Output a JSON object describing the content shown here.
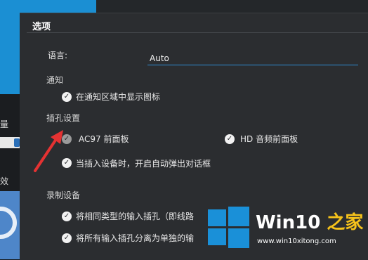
{
  "background": {
    "left_labels": [
      "量",
      "效"
    ]
  },
  "dialog": {
    "title": "选项",
    "language": {
      "label": "语言:",
      "value": "Auto"
    },
    "notify": {
      "heading": "通知",
      "show_icon": {
        "label": "在通知区域中显示图标",
        "checked": true
      }
    },
    "jack": {
      "heading": "插孔设置",
      "ac97": {
        "label": "AC97 前面板",
        "checked": true
      },
      "hd": {
        "label": "HD 音频前面板",
        "checked": true
      },
      "auto_popup": {
        "label": "当插入设备时，开启自动弹出对话框",
        "checked": true
      }
    },
    "record": {
      "heading": "录制设备",
      "same_type": {
        "label": "将相同类型的输入插孔（即线路",
        "checked": true
      },
      "split_all": {
        "label": "将所有输入插孔分离为单独的输",
        "checked": true
      }
    }
  },
  "watermark": {
    "brand_main": "Win10",
    "brand_accent": "之家",
    "url": "www.win10xitong.com"
  },
  "colors": {
    "dialog_bg": "#2b2d30",
    "accent": "#2d8fd8",
    "arrow": "#e53232",
    "watermark_blue": "#1a90d8"
  }
}
